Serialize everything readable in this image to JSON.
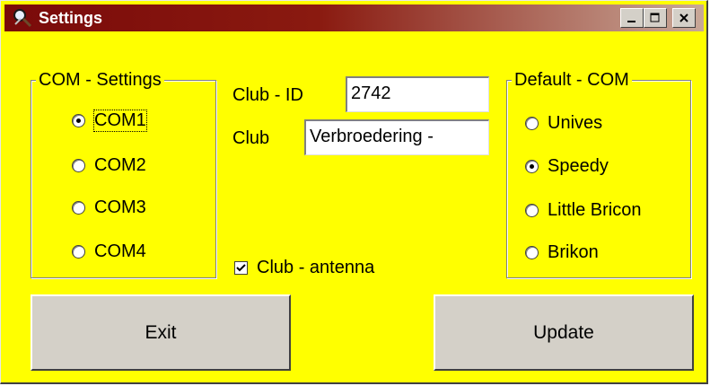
{
  "window": {
    "title": "Settings",
    "title_bar_colors": {
      "left": "#7a0a0a",
      "right": "#c8a898"
    },
    "background_color": "#ffff00"
  },
  "com_settings": {
    "legend": "COM - Settings",
    "options": [
      {
        "label": "COM1",
        "selected": true,
        "focused": true
      },
      {
        "label": "COM2",
        "selected": false
      },
      {
        "label": "COM3",
        "selected": false
      },
      {
        "label": "COM4",
        "selected": false
      }
    ]
  },
  "club": {
    "id_label": "Club - ID",
    "id_value": "2742",
    "name_label": "Club",
    "name_value": "Verbroedering - ",
    "antenna_label": "Club - antenna",
    "antenna_checked": true
  },
  "default_com": {
    "legend": "Default - COM",
    "options": [
      {
        "label": "Unives",
        "selected": false
      },
      {
        "label": "Speedy",
        "selected": true
      },
      {
        "label": "Little Bricon",
        "selected": false
      },
      {
        "label": "Brikon",
        "selected": false
      }
    ]
  },
  "buttons": {
    "exit": "Exit",
    "update": "Update"
  },
  "icons": {
    "app": "magnifier-wrench-icon",
    "minimize": "minimize-icon",
    "maximize": "maximize-icon",
    "close": "close-icon"
  }
}
